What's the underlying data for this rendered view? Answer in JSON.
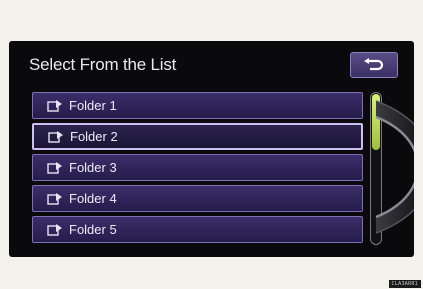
{
  "header": {
    "title": "Select From the List",
    "back_icon": "return-arrow-icon"
  },
  "list": {
    "items": [
      {
        "label": "Folder 1",
        "icon": "folder-play-icon",
        "selected": false
      },
      {
        "label": "Folder 2",
        "icon": "folder-play-icon",
        "selected": true
      },
      {
        "label": "Folder 3",
        "icon": "folder-play-icon",
        "selected": false
      },
      {
        "label": "Folder 4",
        "icon": "folder-play-icon",
        "selected": false
      },
      {
        "label": "Folder 5",
        "icon": "folder-play-icon",
        "selected": false
      }
    ]
  },
  "scrollbar": {
    "position": 0
  },
  "footer": {
    "code": "CLA3AR01"
  },
  "colors": {
    "item_bg": "#2f2559",
    "item_border": "#7d6fba",
    "selected_border": "#cdbff0",
    "scroll_thumb": "#c4de5a"
  }
}
